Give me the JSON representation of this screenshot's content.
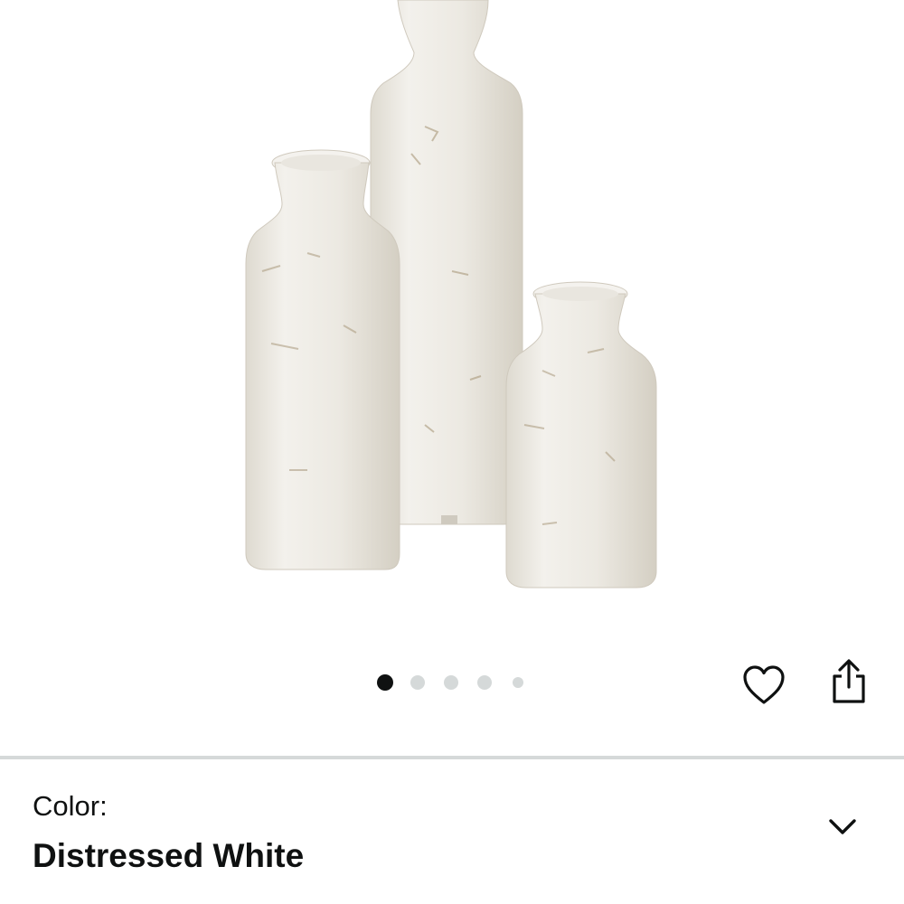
{
  "gallery": {
    "image_count": 5,
    "active_index": 0,
    "image_subject": "three distressed white ceramic vases"
  },
  "actions": {
    "wishlist_icon": "heart-outline-icon",
    "share_icon": "share-icon"
  },
  "variation": {
    "label": "Color:",
    "value": "Distressed White",
    "expand_icon": "chevron-down-icon"
  },
  "colors": {
    "text": "#0f1111",
    "divider": "#d5d9d9",
    "dot_active": "#0f1111",
    "dot_inactive": "#d5d9d9"
  }
}
